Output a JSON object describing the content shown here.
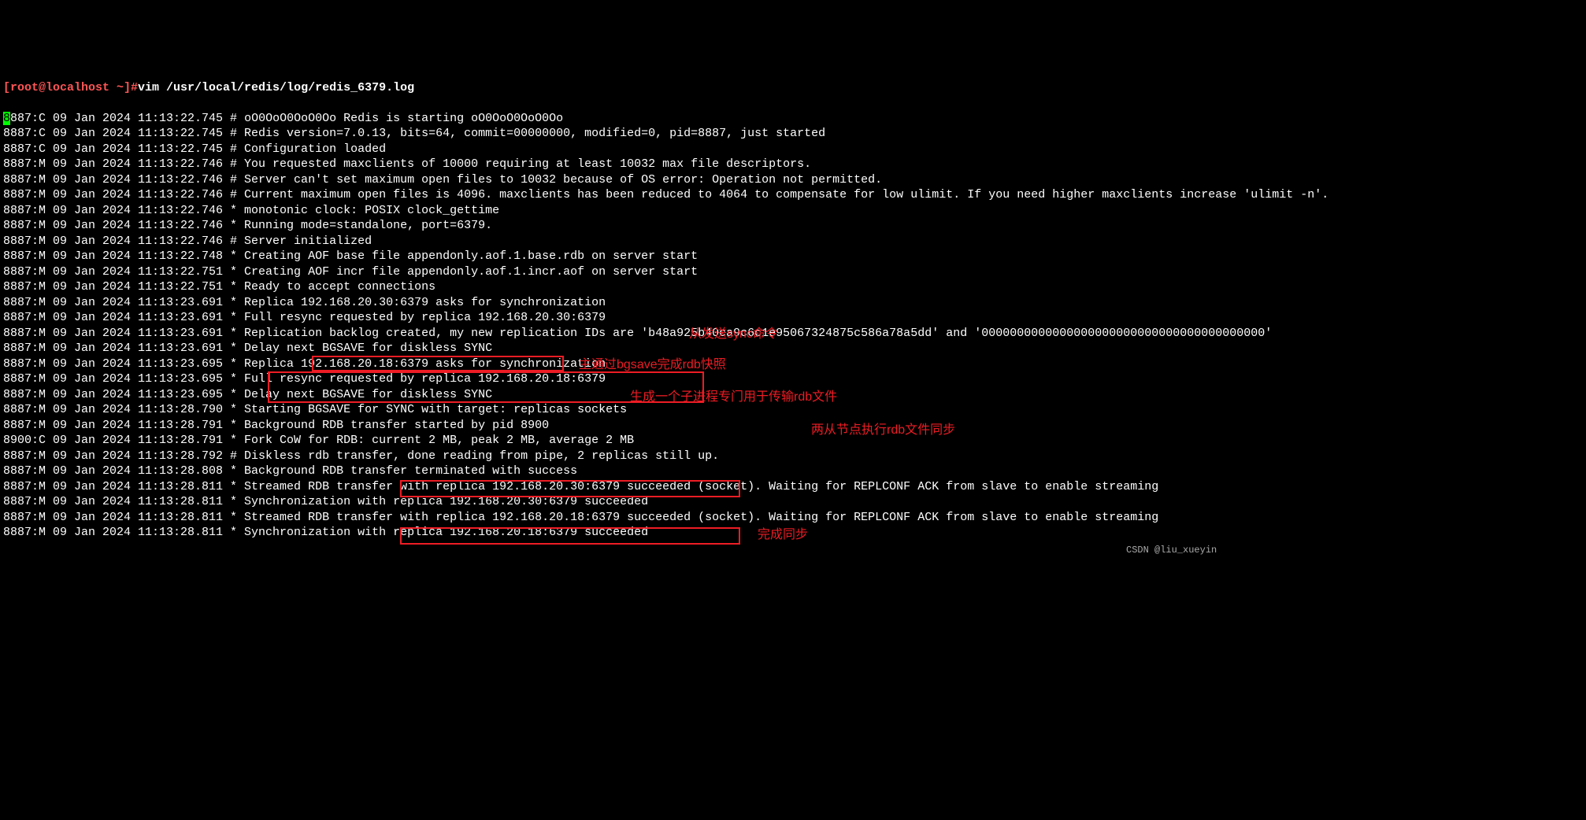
{
  "prompt": {
    "user": "[root@localhost ~]#",
    "command": "vim /usr/local/redis/log/redis_6379.log"
  },
  "cursor_char": "8",
  "log_lines": [
    "887:C 09 Jan 2024 11:13:22.745 # oO0OoO0OoO0Oo Redis is starting oO0OoO0OoO0Oo",
    "8887:C 09 Jan 2024 11:13:22.745 # Redis version=7.0.13, bits=64, commit=00000000, modified=0, pid=8887, just started",
    "8887:C 09 Jan 2024 11:13:22.745 # Configuration loaded",
    "8887:M 09 Jan 2024 11:13:22.746 # You requested maxclients of 10000 requiring at least 10032 max file descriptors.",
    "8887:M 09 Jan 2024 11:13:22.746 # Server can't set maximum open files to 10032 because of OS error: Operation not permitted.",
    "8887:M 09 Jan 2024 11:13:22.746 # Current maximum open files is 4096. maxclients has been reduced to 4064 to compensate for low ulimit. If you need higher maxclients increase 'ulimit -n'.",
    "8887:M 09 Jan 2024 11:13:22.746 * monotonic clock: POSIX clock_gettime",
    "8887:M 09 Jan 2024 11:13:22.746 * Running mode=standalone, port=6379.",
    "8887:M 09 Jan 2024 11:13:22.746 # Server initialized",
    "8887:M 09 Jan 2024 11:13:22.748 * Creating AOF base file appendonly.aof.1.base.rdb on server start",
    "8887:M 09 Jan 2024 11:13:22.751 * Creating AOF incr file appendonly.aof.1.incr.aof on server start",
    "8887:M 09 Jan 2024 11:13:22.751 * Ready to accept connections",
    "8887:M 09 Jan 2024 11:13:23.691 * Replica 192.168.20.30:6379 asks for synchronization",
    "8887:M 09 Jan 2024 11:13:23.691 * Full resync requested by replica 192.168.20.30:6379",
    "8887:M 09 Jan 2024 11:13:23.691 * Replication backlog created, my new replication IDs are 'b48a925b40ca9c6c1e95067324875c586a78a5dd' and '0000000000000000000000000000000000000000'",
    "8887:M 09 Jan 2024 11:13:23.691 * Delay next BGSAVE for diskless SYNC",
    "8887:M 09 Jan 2024 11:13:23.695 * Replica 192.168.20.18:6379 asks for synchronization",
    "8887:M 09 Jan 2024 11:13:23.695 * Full resync requested by replica 192.168.20.18:6379",
    "8887:M 09 Jan 2024 11:13:23.695 * Delay next BGSAVE for diskless SYNC",
    "8887:M 09 Jan 2024 11:13:28.790 * Starting BGSAVE for SYNC with target: replicas sockets",
    "8887:M 09 Jan 2024 11:13:28.791 * Background RDB transfer started by pid 8900",
    "8900:C 09 Jan 2024 11:13:28.791 * Fork CoW for RDB: current 2 MB, peak 2 MB, average 2 MB",
    "8887:M 09 Jan 2024 11:13:28.792 # Diskless rdb transfer, done reading from pipe, 2 replicas still up.",
    "8887:M 09 Jan 2024 11:13:28.808 * Background RDB transfer terminated with success",
    "8887:M 09 Jan 2024 11:13:28.811 * Streamed RDB transfer with replica 192.168.20.30:6379 succeeded (socket). Waiting for REPLCONF ACK from slave to enable streaming",
    "8887:M 09 Jan 2024 11:13:28.811 * Synchronization with replica 192.168.20.30:6379 succeeded",
    "8887:M 09 Jan 2024 11:13:28.811 * Streamed RDB transfer with replica 192.168.20.18:6379 succeeded (socket). Waiting for REPLCONF ACK from slave to enable streaming",
    "8887:M 09 Jan 2024 11:13:28.811 * Synchronization with replica 192.168.20.18:6379 succeeded"
  ],
  "annotations": {
    "sync_cmd": "从发送sync命令",
    "bgsave_rdb": "主通过bgsave完成rdb快照",
    "child_process": "生成一个子进程专门用于传输rdb文件",
    "replica_sync": "两从节点执行rdb文件同步",
    "sync_complete": "完成同步"
  },
  "watermark": "CSDN @liu_xueyin"
}
